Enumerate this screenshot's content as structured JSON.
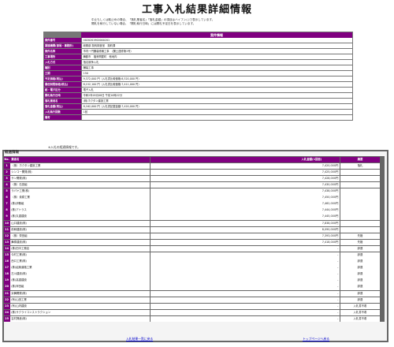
{
  "title": "工事入札結果詳細情報",
  "notes": [
    "中止もしくは取止めの場合、「落札業者名」「落札金額」の項目はハイフン(-)で表示しています。",
    "開札を執行していない場合、「開札執行日時」には開札予定日を表示しています。"
  ],
  "summary": {
    "header": "案件情報",
    "rows": [
      {
        "label": "案件番号",
        "value": "4020201900000201"
      },
      {
        "label": "調達機関(部局・事務所)",
        "value": "総務部 契約検査室　契約課"
      },
      {
        "label": "案件名称",
        "value": "市内一円舗装修繕工事　（舗土連修第1号）"
      },
      {
        "label": "工事場所",
        "value": "舞鶴市　福来問屋町　他地内"
      },
      {
        "label": "入札方式",
        "value": "指名競争入札"
      },
      {
        "label": "種別",
        "value": "舗装工事"
      },
      {
        "label": "工期",
        "value": "150"
      },
      {
        "label": "予定価格(税込)",
        "value": "9,372,000 円（入札書比較価格:8,520,000 円）"
      },
      {
        "label": "最低制限価格(税込)",
        "value": "8,152,100 円（入札書比較価格:7,411,000 円）"
      },
      {
        "label": "紙・電子区分",
        "value": "電子入札"
      },
      {
        "label": "開札執行日時",
        "value": "令和2年05月08日 午前10時22分"
      },
      {
        "label": "落札業者名",
        "value": "(株)ホクタン建設工業"
      },
      {
        "label": "落札金額(税込)",
        "value": "8,162,000 円（入札書記載金額:7,420,000 円）"
      },
      {
        "label": "入札執行回数",
        "value": "1回"
      },
      {
        "label": "備考",
        "value": ""
      }
    ]
  },
  "progress_note": "※入札の経過情報です。",
  "progress": {
    "title": "経過情報",
    "columns": {
      "no": "No.",
      "name": "業者名",
      "amount": "入札金額(1回目)",
      "note": "摘要"
    },
    "rows": [
      {
        "no": "1",
        "name": "（株）ホクタン建設工業",
        "amount": "7,420,000円",
        "note": "落札"
      },
      {
        "no": "2",
        "name": "シンコー開発(株)",
        "amount": "7,425,000円",
        "note": ""
      },
      {
        "no": "3",
        "name": "サン開発(株)",
        "amount": "7,428,000円",
        "note": ""
      },
      {
        "no": "4",
        "name": "（株）石田組",
        "amount": "7,430,000円",
        "note": ""
      },
      {
        "no": "5",
        "name": "ラパヤ工業(株)",
        "amount": "7,438,000円",
        "note": ""
      },
      {
        "no": "6",
        "name": "（株）貴原工業",
        "amount": "7,450,000円",
        "note": ""
      },
      {
        "no": "7",
        "name": "(株)伊藤組",
        "amount": "7,462,000円",
        "note": ""
      },
      {
        "no": "8",
        "name": "(株)アトラス",
        "amount": "7,444,000円",
        "note": ""
      },
      {
        "no": "9",
        "name": "(株)丸重建設",
        "amount": "7,445,000円",
        "note": ""
      },
      {
        "no": "10",
        "name": "山口建設(株)",
        "amount": "7,838,000円",
        "note": ""
      },
      {
        "no": "11",
        "name": "前和建設(株)",
        "amount": "8,090,000円",
        "note": ""
      },
      {
        "no": "12",
        "name": "（株）栄田組",
        "amount": "7,393,000円",
        "note": "失格"
      },
      {
        "no": "13",
        "name": "舞泰建設(株)",
        "amount": "7,418,000円",
        "note": "失格"
      },
      {
        "no": "14",
        "name": "(株)田中工務店",
        "amount": "-",
        "note": "辞退"
      },
      {
        "no": "15",
        "name": "今村工業(株)",
        "amount": "-",
        "note": "辞退"
      },
      {
        "no": "16",
        "name": "西口工業(株)",
        "amount": "-",
        "note": "辞退"
      },
      {
        "no": "17",
        "name": "(株)紹風道路工業",
        "amount": "-",
        "note": "辞退"
      },
      {
        "no": "18",
        "name": "古川建設(株)",
        "amount": "-",
        "note": "辞退"
      },
      {
        "no": "19",
        "name": "(株)高重建設",
        "amount": "-",
        "note": "辞退"
      },
      {
        "no": "20",
        "name": "(株)岸田組",
        "amount": "-",
        "note": "辞退"
      },
      {
        "no": "21",
        "name": "京舞開発(株)",
        "amount": "-",
        "note": "辞退"
      },
      {
        "no": "22",
        "name": "(有)山田工業",
        "amount": "-",
        "note": "辞退"
      },
      {
        "no": "23",
        "name": "(有)山内建設",
        "amount": "-",
        "note": "入札書不着"
      },
      {
        "no": "24",
        "name": "(株)サクライコンストラクション",
        "amount": "-",
        "note": "入札書不着"
      },
      {
        "no": "25",
        "name": "吉村興産(株)",
        "amount": "-",
        "note": "入札書不着"
      }
    ]
  },
  "links": {
    "back_list": "入札結果一覧に戻る",
    "top": "トップページへ戻る"
  },
  "colors": {
    "header": "#800080",
    "link": "#0000cc"
  }
}
